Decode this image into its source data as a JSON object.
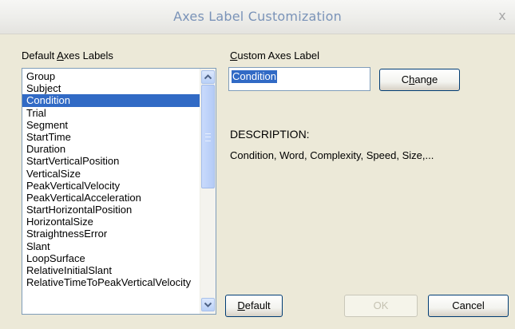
{
  "window": {
    "title": "Axes Label Customization",
    "close_glyph": "x"
  },
  "default_labels": {
    "heading_prefix": "Default ",
    "heading_mnemonic": "A",
    "heading_suffix": "xes Labels",
    "selected_index": 2,
    "items": [
      "Group",
      "Subject",
      "Condition",
      "Trial",
      "Segment",
      "StartTime",
      "Duration",
      "StartVerticalPosition",
      "VerticalSize",
      "PeakVerticalVelocity",
      "PeakVerticalAcceleration",
      "StartHorizontalPosition",
      "HorizontalSize",
      "StraightnessError",
      "Slant",
      "LoopSurface",
      "RelativeInitialSlant",
      "RelativeTimeToPeakVerticalVelocity"
    ]
  },
  "custom_label": {
    "heading_mnemonic": "C",
    "heading_suffix": "ustom Axes Label",
    "value": "Condition"
  },
  "description": {
    "heading": "DESCRIPTION:",
    "text": "Condition, Word, Complexity, Speed, Size,..."
  },
  "buttons": {
    "change_prefix": "C",
    "change_mnemonic": "h",
    "change_suffix": "ange",
    "default_mnemonic": "D",
    "default_suffix": "efault",
    "ok": "OK",
    "ok_enabled": false,
    "cancel": "Cancel"
  },
  "colors": {
    "title_text": "#7a93b8",
    "selection": "#316ac5",
    "dialog_background": "#ece9d8"
  }
}
